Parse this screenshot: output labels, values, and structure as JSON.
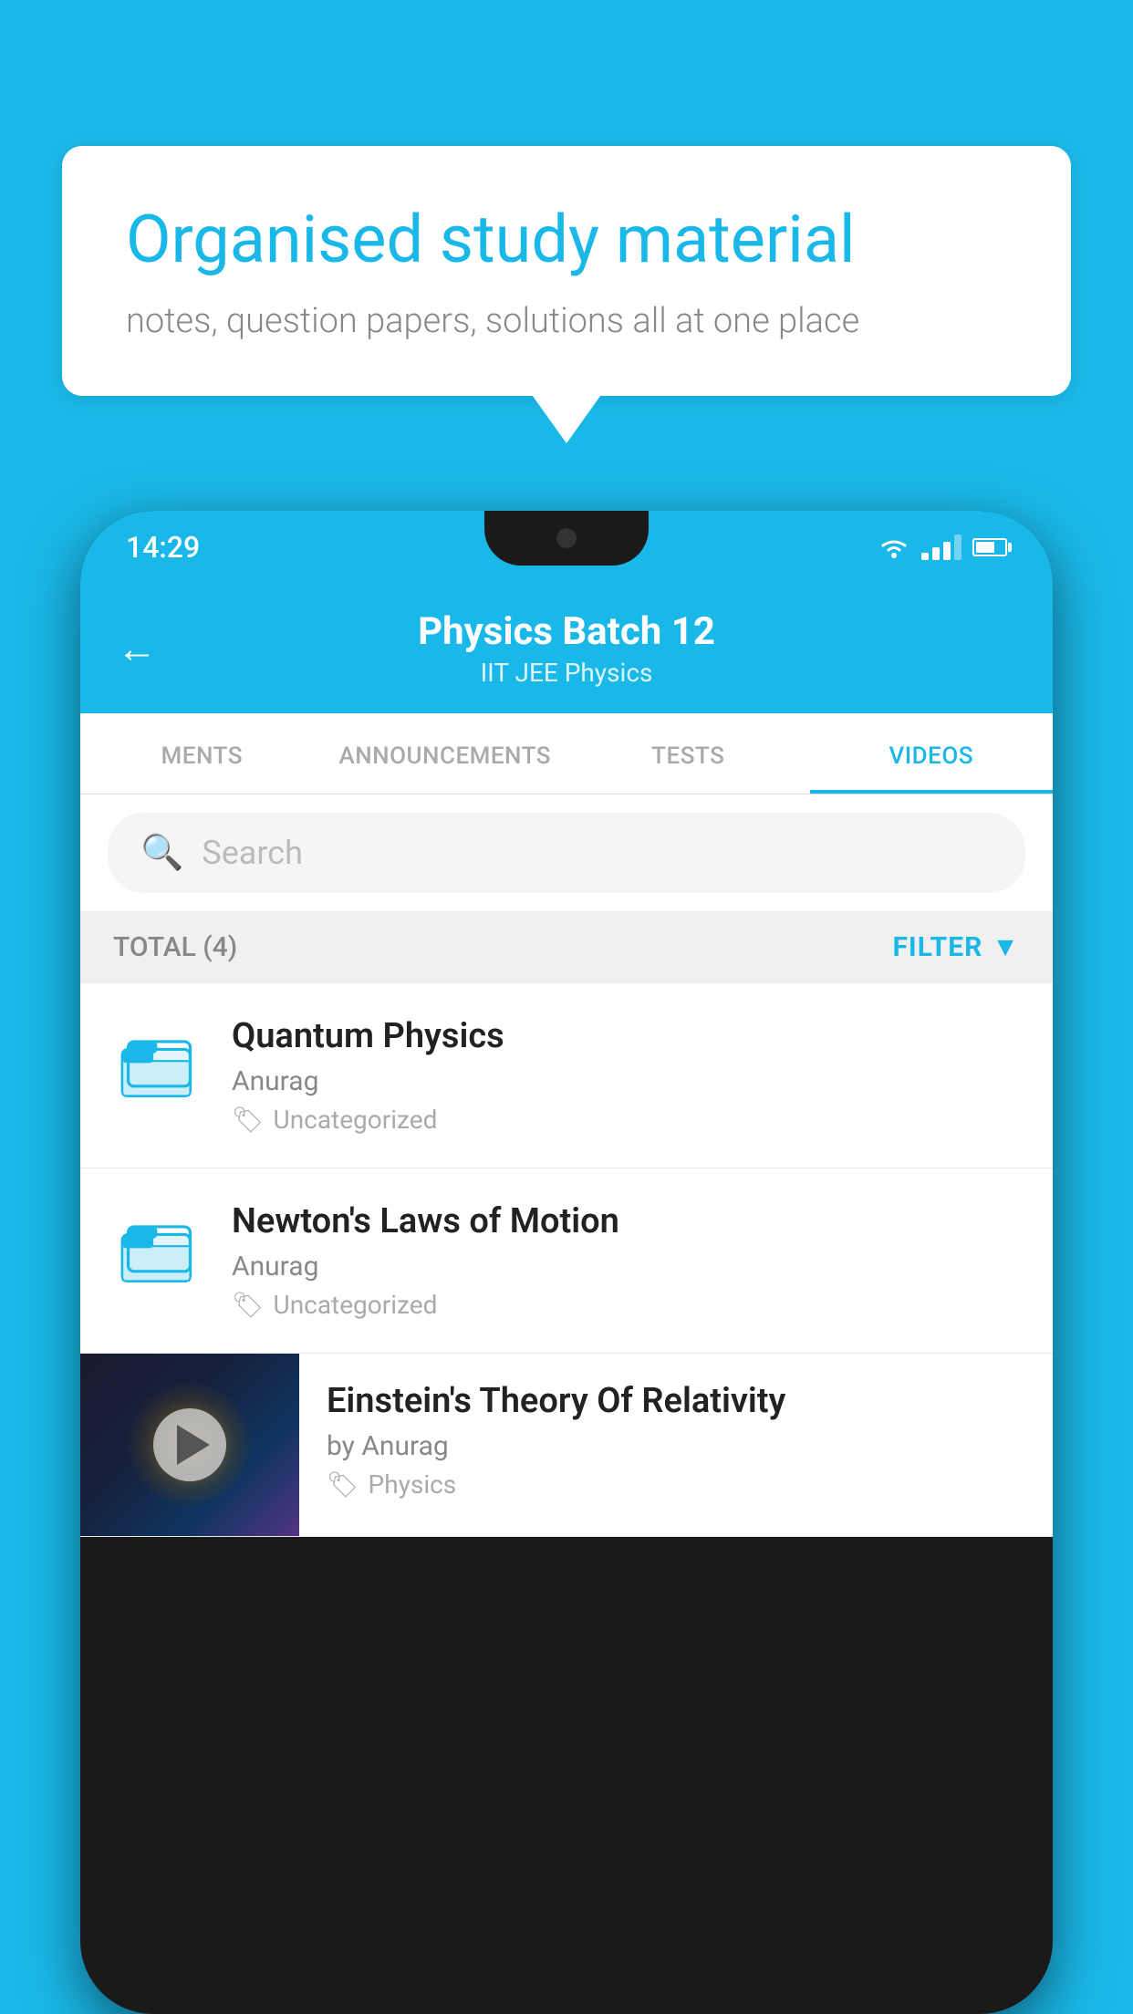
{
  "background_color": "#1ab8e8",
  "speech_bubble": {
    "title": "Organised study material",
    "subtitle": "notes, question papers, solutions all at one place"
  },
  "phone": {
    "status_bar": {
      "time": "14:29"
    },
    "header": {
      "title": "Physics Batch 12",
      "subtitle": "IIT JEE   Physics",
      "back_label": "←"
    },
    "tabs": [
      {
        "label": "MENTS",
        "active": false
      },
      {
        "label": "ANNOUNCEMENTS",
        "active": false
      },
      {
        "label": "TESTS",
        "active": false
      },
      {
        "label": "VIDEOS",
        "active": true
      }
    ],
    "search": {
      "placeholder": "Search"
    },
    "filter": {
      "total_label": "TOTAL (4)",
      "filter_label": "FILTER"
    },
    "videos": [
      {
        "title": "Quantum Physics",
        "author": "Anurag",
        "tag": "Uncategorized",
        "type": "folder"
      },
      {
        "title": "Newton's Laws of Motion",
        "author": "Anurag",
        "tag": "Uncategorized",
        "type": "folder"
      },
      {
        "title": "Einstein's Theory Of Relativity",
        "author": "by Anurag",
        "tag": "Physics",
        "type": "video"
      }
    ]
  }
}
